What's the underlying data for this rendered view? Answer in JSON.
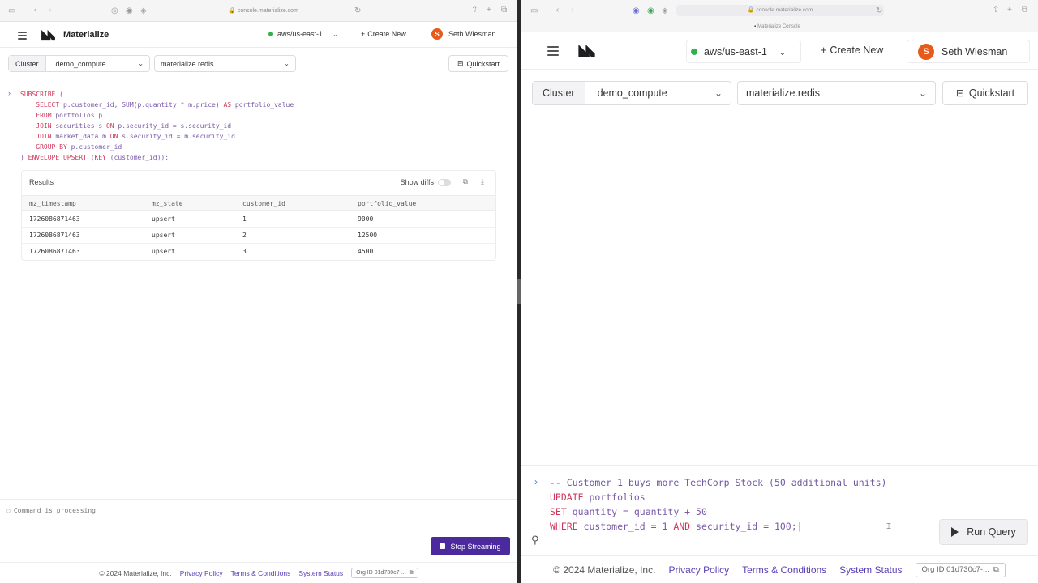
{
  "left": {
    "browser": {
      "url": "console.materialize.com"
    },
    "header": {
      "brand": "Materialize",
      "region": "aws/us-east-1",
      "create_new": "Create New",
      "user_initial": "S",
      "user_name": "Seth Wiesman"
    },
    "toolbar": {
      "cluster_label": "Cluster",
      "cluster_value": "demo_compute",
      "database_value": "materialize.redis",
      "quickstart": "Quickstart"
    },
    "query": {
      "l1": [
        "SUBSCRIBE",
        " ("
      ],
      "l2": [
        "SELECT",
        " p.customer_id, SUM(p.quantity * m.price) ",
        "AS",
        " portfolio_value"
      ],
      "l3": [
        "FROM",
        " portfolios p"
      ],
      "l4": [
        "JOIN",
        " securities s ",
        "ON",
        " p.security_id = s.security_id"
      ],
      "l5": [
        "JOIN",
        " market_data m ",
        "ON",
        " s.security_id = m.security_id"
      ],
      "l6": [
        "GROUP BY",
        " p.customer_id"
      ],
      "l7": [
        ") ",
        "ENVELOPE UPSERT",
        " (",
        "KEY",
        " (customer_id));"
      ]
    },
    "results": {
      "title": "Results",
      "show_diffs": "Show diffs",
      "columns": [
        "mz_timestamp",
        "mz_state",
        "customer_id",
        "portfolio_value"
      ],
      "rows": [
        [
          "1726086871463",
          "upsert",
          "1",
          "9000"
        ],
        [
          "1726086871463",
          "upsert",
          "2",
          "12500"
        ],
        [
          "1726086871463",
          "upsert",
          "3",
          "4500"
        ]
      ]
    },
    "status": "Command is processing",
    "stop_streaming": "Stop Streaming",
    "footer": {
      "copyright": "© 2024 Materialize, Inc.",
      "privacy": "Privacy Policy",
      "terms": "Terms & Conditions",
      "status": "System Status",
      "org": "Org ID 01d730c7-..."
    }
  },
  "right": {
    "browser": {
      "url": "console.materialize.com",
      "tab": "Materialize Console"
    },
    "header": {
      "region": "aws/us-east-1",
      "create_new": "Create New",
      "user_initial": "S",
      "user_name": "Seth Wiesman"
    },
    "toolbar": {
      "cluster_label": "Cluster",
      "cluster_value": "demo_compute",
      "database_value": "materialize.redis",
      "quickstart": "Quickstart"
    },
    "query": {
      "l1": "-- Customer 1 buys more TechCorp Stock (50 additional units)",
      "l2": [
        "UPDATE",
        " portfolios"
      ],
      "l3": [
        "SET",
        " quantity = quantity + 50"
      ],
      "l4": [
        "WHERE",
        " customer_id = 1 ",
        "AND",
        " security_id = 100;"
      ]
    },
    "run_query": "Run Query",
    "footer": {
      "copyright": "© 2024 Materialize, Inc.",
      "privacy": "Privacy Policy",
      "terms": "Terms & Conditions",
      "status": "System Status",
      "org": "Org ID 01d730c7-..."
    }
  },
  "colors": {
    "accent": "#4b2a9e",
    "link": "#5b3fb5",
    "keyword": "#d0365b",
    "online": "#2db34a",
    "avatar": "#e65b1b"
  }
}
